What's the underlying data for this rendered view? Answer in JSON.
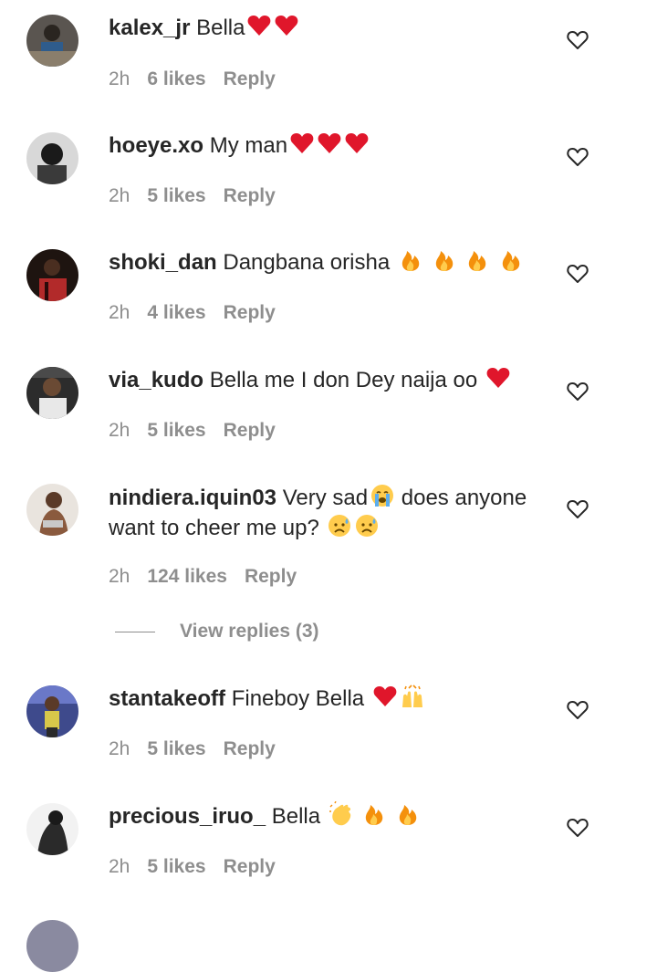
{
  "comments": [
    {
      "username": "kalex_jr",
      "text": "Bella",
      "emojis": [
        "heart",
        "heart"
      ],
      "time": "2h",
      "likes": "6 likes",
      "reply": "Reply"
    },
    {
      "username": "hoeye.xo",
      "text": "My man",
      "emojis": [
        "heart",
        "heart",
        "heart"
      ],
      "time": "2h",
      "likes": "5 likes",
      "reply": "Reply"
    },
    {
      "username": "shoki_dan",
      "text": "Dangbana orisha",
      "emojis": [
        "fire",
        "fire",
        "fire",
        "fire"
      ],
      "time": "2h",
      "likes": "4 likes",
      "reply": "Reply"
    },
    {
      "username": "via_kudo",
      "text": "Bella me I don Dey naija oo",
      "emojis": [
        "heart"
      ],
      "time": "2h",
      "likes": "5 likes",
      "reply": "Reply"
    },
    {
      "username": "nindiera.iquin03",
      "text": "Very sad",
      "emojis": [
        "crying-face"
      ],
      "text2": "does anyone want to cheer me up?",
      "emojis2": [
        "sad-sweat-face",
        "sad-sweat-face"
      ],
      "time": "2h",
      "likes": "124 likes",
      "reply": "Reply"
    },
    {
      "username": "stantakeoff",
      "text": "Fineboy Bella",
      "emojis": [
        "heart",
        "raising-hands"
      ],
      "time": "2h",
      "likes": "5 likes",
      "reply": "Reply"
    },
    {
      "username": "precious_iruo_",
      "text": "Bella",
      "emojis": [
        "clapping-hands",
        "fire",
        "fire"
      ],
      "time": "2h",
      "likes": "5 likes",
      "reply": "Reply"
    }
  ],
  "view_replies": "View replies (3)",
  "colors": {
    "text": "#262626",
    "meta": "#8e8e8e",
    "heart_emoji": "#e0162b",
    "fire_emoji": "#f4900c"
  },
  "icons": {
    "like": "heart-outline-icon"
  }
}
